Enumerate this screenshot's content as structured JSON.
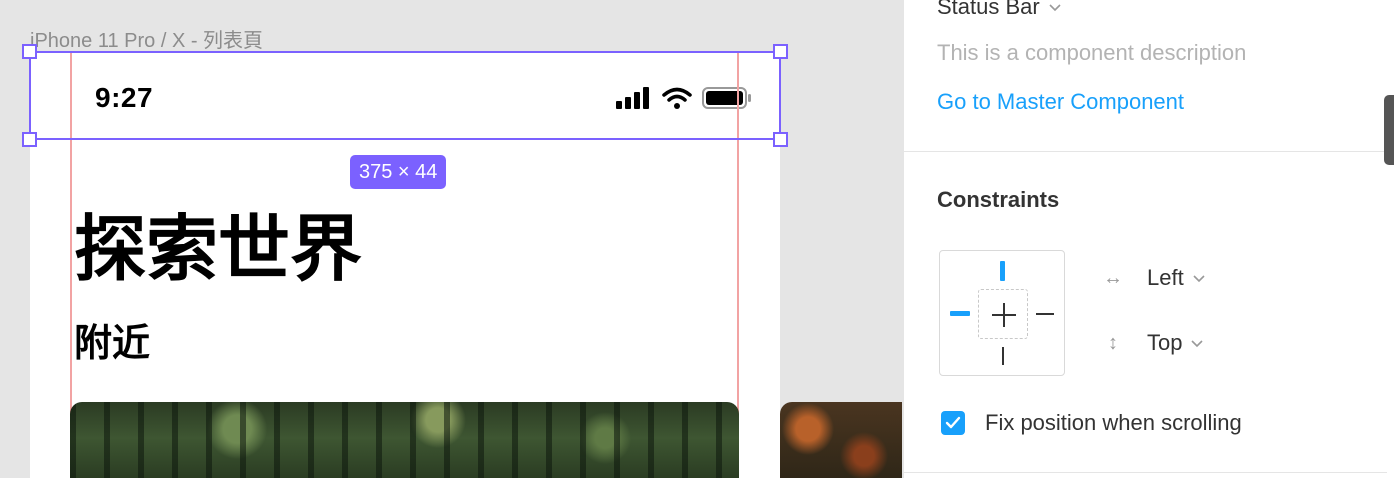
{
  "canvas": {
    "frame_label": "iPhone 11 Pro / X - 列表頁",
    "status_bar": {
      "time": "9:27"
    },
    "selection_size": "375 × 44",
    "heading": "探索世界",
    "subheading": "附近"
  },
  "panel": {
    "component_name": "Status Bar",
    "component_description": "This is a component description",
    "master_link": "Go to Master Component",
    "constraints": {
      "title": "Constraints",
      "horizontal": "Left",
      "vertical": "Top"
    },
    "fix_position_label": "Fix position when scrolling",
    "fix_position_checked": true
  },
  "colors": {
    "selection": "#7b61ff",
    "accent": "#18a0fb",
    "layout_guide": "#f2a3a3"
  },
  "icons": [
    "cellular-signal-icon",
    "wifi-icon",
    "battery-icon",
    "chevron-down-icon",
    "horizontal-resize-icon",
    "vertical-resize-icon",
    "checkmark-icon"
  ]
}
